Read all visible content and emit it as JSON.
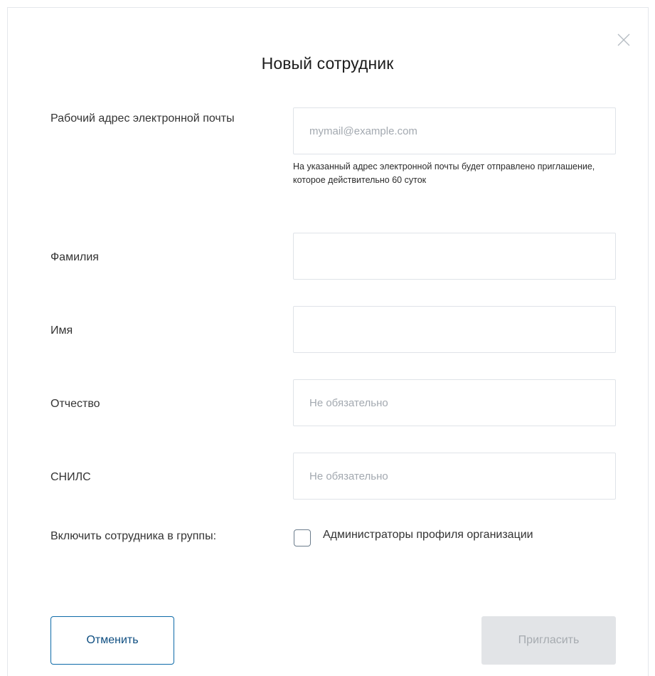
{
  "dialog": {
    "title": "Новый сотрудник",
    "close_icon": "close-icon"
  },
  "form": {
    "email": {
      "label": "Рабочий адрес электронной почты",
      "value": "",
      "placeholder": "mymail@example.com",
      "hint": "На указанный адрес электронной почты будет отправлено приглашение, которое действительно 60 суток"
    },
    "last_name": {
      "label": "Фамилия",
      "value": "",
      "placeholder": ""
    },
    "first_name": {
      "label": "Имя",
      "value": "",
      "placeholder": ""
    },
    "middle_name": {
      "label": "Отчество",
      "value": "",
      "placeholder": "Не обязательно"
    },
    "snils": {
      "label": "СНИЛС",
      "value": "",
      "placeholder": "Не обязательно"
    },
    "groups": {
      "label": "Включить сотрудника в группы:",
      "options": [
        {
          "label": "Администраторы профиля организации",
          "checked": false
        }
      ]
    }
  },
  "actions": {
    "cancel_label": "Отменить",
    "invite_label": "Пригласить",
    "invite_enabled": false
  },
  "colors": {
    "accent": "#0d6aa8",
    "cancel_text": "#0d4d80",
    "disabled_bg": "#e2e4e7",
    "disabled_text": "#a6abb0",
    "field_border": "#dfe3e8",
    "placeholder": "#a3a9b0"
  }
}
